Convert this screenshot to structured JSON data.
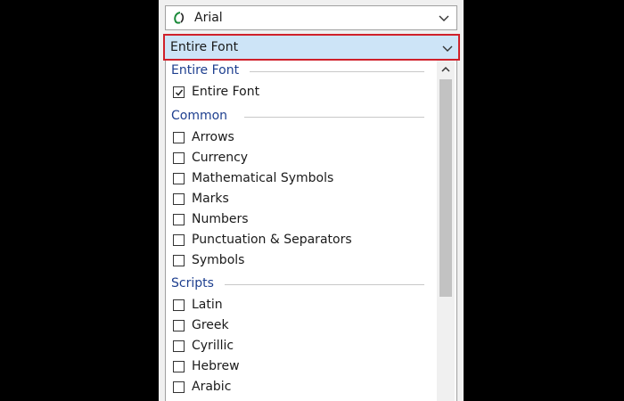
{
  "font_select": {
    "value": "Arial",
    "icon": "opentype-font-icon"
  },
  "subset_select": {
    "value": "Entire Font"
  },
  "dropdown": {
    "entire_font_header": "Entire Font",
    "entire_font_item": {
      "label": "Entire Font",
      "checked": true
    },
    "common_header": "Common",
    "common_items": [
      {
        "label": "Arrows",
        "checked": false
      },
      {
        "label": "Currency",
        "checked": false
      },
      {
        "label": "Mathematical Symbols",
        "checked": false
      },
      {
        "label": "Marks",
        "checked": false
      },
      {
        "label": "Numbers",
        "checked": false
      },
      {
        "label": "Punctuation & Separators",
        "checked": false
      },
      {
        "label": "Symbols",
        "checked": false
      }
    ],
    "scripts_header": "Scripts",
    "scripts_items": [
      {
        "label": "Latin",
        "checked": false
      },
      {
        "label": "Greek",
        "checked": false
      },
      {
        "label": "Cyrillic",
        "checked": false
      },
      {
        "label": "Hebrew",
        "checked": false
      },
      {
        "label": "Arabic",
        "checked": false
      }
    ]
  },
  "colors": {
    "highlight": "#cde4f7",
    "outline": "#d0202a",
    "group_header": "#1e3f8f"
  }
}
